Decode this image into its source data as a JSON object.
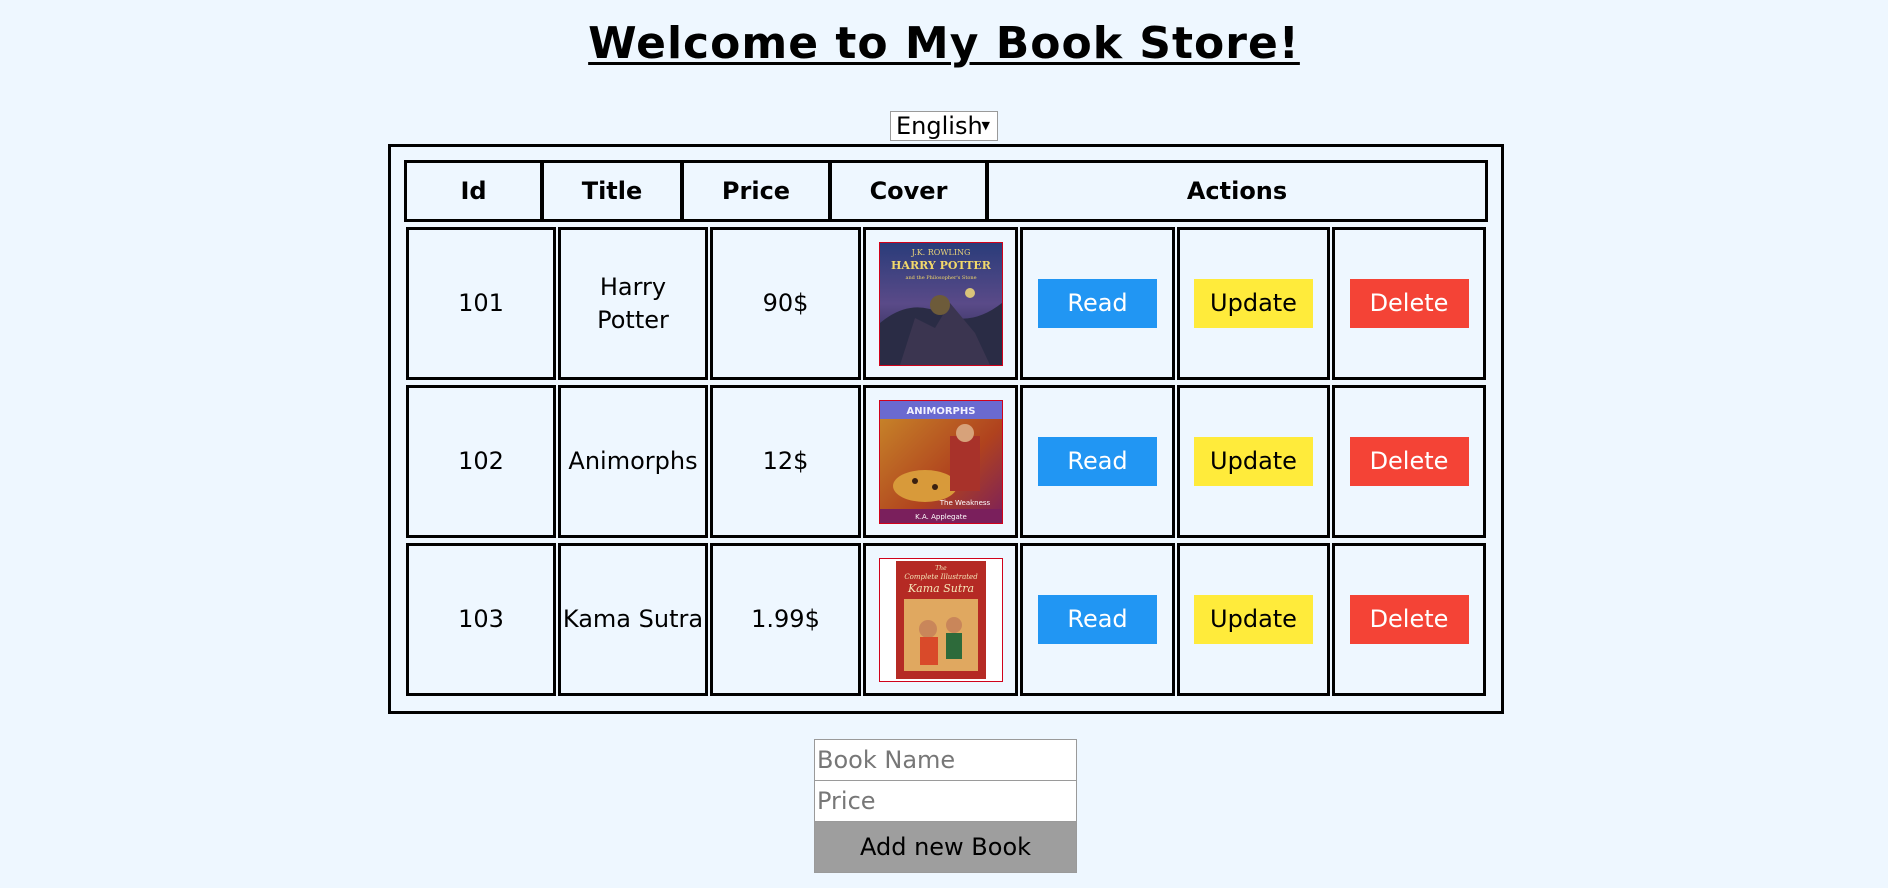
{
  "page": {
    "title": "Welcome to My Book Store!"
  },
  "language": {
    "selected": "English"
  },
  "table": {
    "headers": {
      "id": "Id",
      "title": "Title",
      "price": "Price",
      "cover": "Cover",
      "actions": "Actions"
    },
    "rows": [
      {
        "id": "101",
        "title": "Harry Potter",
        "price": "90$"
      },
      {
        "id": "102",
        "title": "Animorphs",
        "price": "12$"
      },
      {
        "id": "103",
        "title": "Kama Sutra",
        "price": "1.99$"
      }
    ],
    "actions": {
      "read": "Read",
      "update": "Update",
      "delete": "Delete"
    }
  },
  "covers": [
    {
      "top": "J.K. ROWLING",
      "title": "HARRY POTTER",
      "sub": "and the Philosopher's Stone"
    },
    {
      "top": "ANIMORPHS",
      "title": "",
      "sub": "The Weakness",
      "author": "K.A. Applegate"
    },
    {
      "top": "The",
      "title": "Complete Illustrated",
      "sub": "Kama Sutra"
    }
  ],
  "form": {
    "book_name_placeholder": "Book Name",
    "price_placeholder": "Price",
    "add_label": "Add new Book"
  },
  "colors": {
    "background": "#eef7ff",
    "read": "#2196f3",
    "update": "#ffeb3b",
    "delete": "#f44336",
    "add_button": "#9e9e9e"
  }
}
